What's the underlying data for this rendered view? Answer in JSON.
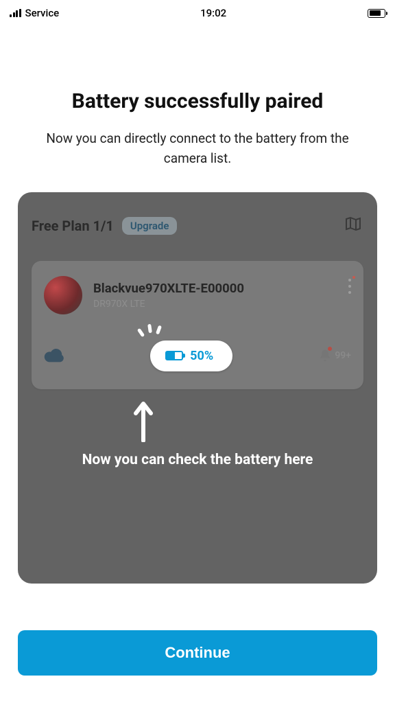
{
  "status_bar": {
    "carrier": "Service",
    "time": "19:02"
  },
  "heading": {
    "title": "Battery successfully paired",
    "subtitle": "Now you can directly connect to the battery from the camera list."
  },
  "overlay": {
    "plan_label": "Free Plan 1/1",
    "upgrade_label": "Upgrade",
    "device": {
      "name": "Blackvue970XLTE-E00000",
      "model": "DR970X LTE",
      "battery_percent": "50%",
      "notifications": "99+"
    },
    "hint_text": "Now you can check the battery here"
  },
  "cta": {
    "continue_label": "Continue"
  },
  "colors": {
    "accent": "#0a9ad6",
    "overlay_bg": "#636363",
    "card_bg": "#7a7a7a"
  }
}
